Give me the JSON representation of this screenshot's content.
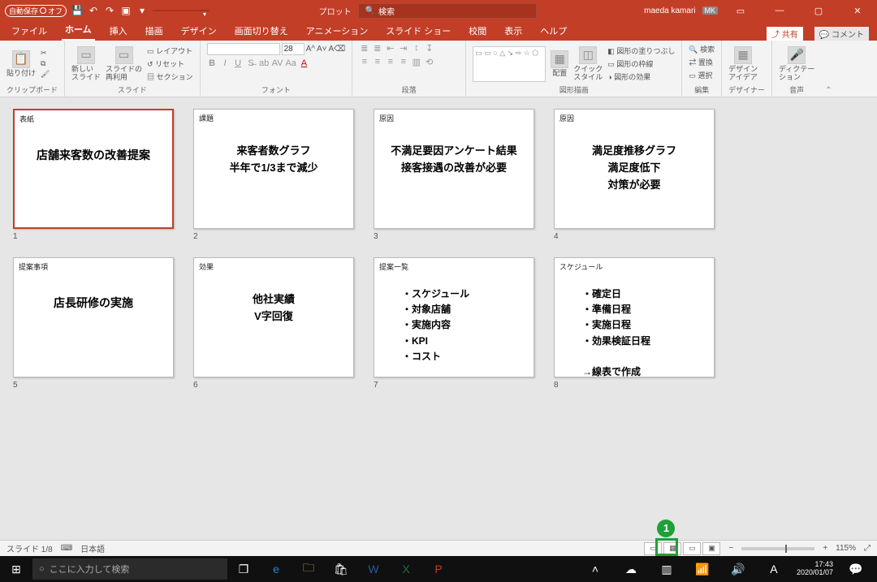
{
  "titlebar": {
    "autosave_label": "自動保存",
    "autosave_state": "オフ",
    "filename": "",
    "app_name": "プロット",
    "search_placeholder": "検索",
    "user_name": "maeda kamari",
    "user_initials": "MK"
  },
  "tabs": {
    "items": [
      "ファイル",
      "ホーム",
      "挿入",
      "描画",
      "デザイン",
      "画面切り替え",
      "アニメーション",
      "スライド ショー",
      "校閲",
      "表示",
      "ヘルプ"
    ],
    "active_index": 1,
    "share": "共有",
    "comment": "コメント"
  },
  "ribbon": {
    "clipboard": {
      "paste": "貼り付け",
      "group": "クリップボード"
    },
    "slides": {
      "new": "新しい\nスライド",
      "reuse": "スライドの\n再利用",
      "layout": "レイアウト",
      "reset": "リセット",
      "section": "セクション",
      "group": "スライド"
    },
    "font": {
      "size": "28",
      "group": "フォント"
    },
    "paragraph": {
      "group": "段落"
    },
    "shapes": {
      "arrange": "配置",
      "quick": "クイック\nスタイル",
      "fill": "図形の塗りつぶし",
      "outline": "図形の枠線",
      "effects": "図形の効果",
      "group": "図形描画"
    },
    "editing": {
      "find": "検索",
      "replace": "置換",
      "select": "選択",
      "group": "編集"
    },
    "designer": {
      "label": "デザイン\nアイデア",
      "group": "デザイナー"
    },
    "voice": {
      "dictate": "ディクテー\nション",
      "group": "音声"
    }
  },
  "slides": [
    {
      "section": "表紙",
      "lines": [
        "店舗来客数の改善提案"
      ],
      "layout": "title",
      "selected": true
    },
    {
      "section": "課題",
      "lines": [
        "来客者数グラフ",
        "半年で1/3まで減少"
      ],
      "layout": "body"
    },
    {
      "section": "原因",
      "lines": [
        "不満足要因アンケート結果",
        "接客接遇の改善が必要"
      ],
      "layout": "body"
    },
    {
      "section": "原因",
      "lines": [
        "満足度推移グラフ",
        "満足度低下",
        "対策が必要"
      ],
      "layout": "body"
    },
    {
      "section": "提案事項",
      "lines": [
        "店長研修の実施"
      ],
      "layout": "title"
    },
    {
      "section": "効果",
      "lines": [
        "他社実績",
        "V字回復"
      ],
      "layout": "body"
    },
    {
      "section": "提案一覧",
      "lines": [
        "・スケジュール",
        "・対象店舗",
        "・実施内容",
        "・KPI",
        "・コスト"
      ],
      "layout": "bullets"
    },
    {
      "section": "スケジュール",
      "lines": [
        "・確定日",
        "・準備日程",
        "・実施日程",
        "・効果検証日程",
        "",
        "→線表で作成"
      ],
      "layout": "bullets"
    }
  ],
  "annotation": {
    "label": "1"
  },
  "statusbar": {
    "slide": "スライド 1/8",
    "lang": "日本語",
    "zoom": "115%"
  },
  "taskbar": {
    "search_placeholder": "ここに入力して検索",
    "time": "17:43",
    "date": "2020/01/07"
  }
}
